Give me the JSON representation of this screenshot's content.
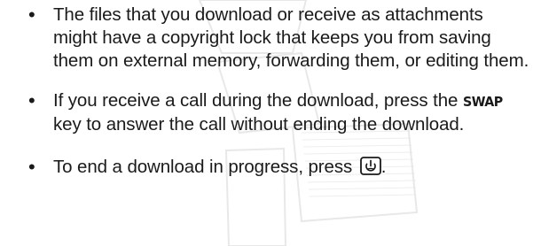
{
  "bullets": [
    {
      "text": "The files that you download or receive as attachments might have a copyright lock that keeps you from saving them on external memory, forwarding them, or editing them."
    },
    {
      "text_before": "If you receive a call during the download, press the ",
      "key_label": "SWAP",
      "text_after": " key to answer the call without ending the download."
    },
    {
      "text_before": "To end a download in progress, press ",
      "key_icon": "end-power-key-icon",
      "text_after": "."
    }
  ]
}
